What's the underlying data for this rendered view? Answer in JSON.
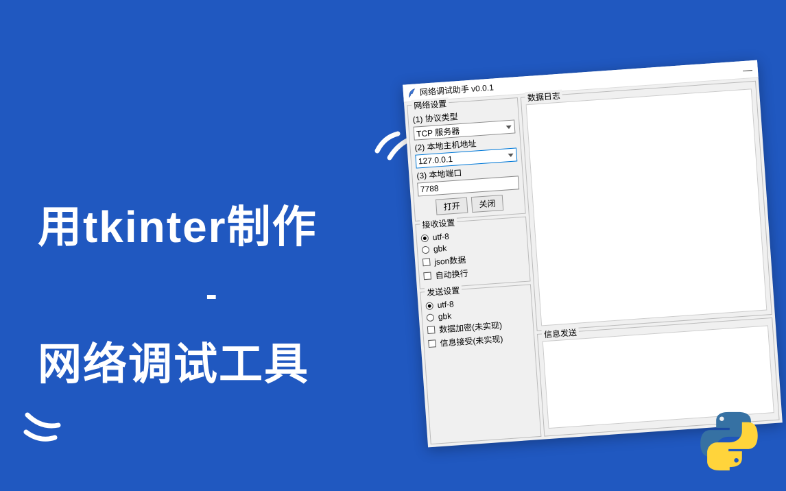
{
  "headline": {
    "line1": "用tkinter制作",
    "dash": "-",
    "line2": "网络调试工具"
  },
  "window": {
    "title": "网络调试助手 v0.0.1"
  },
  "network_settings": {
    "group_title": "网络设置",
    "protocol_label": "(1) 协议类型",
    "protocol_value": "TCP 服务器",
    "host_label": "(2) 本地主机地址",
    "host_value": "127.0.0.1",
    "port_label": "(3) 本地端口",
    "port_value": "7788",
    "open_btn": "打开",
    "close_btn": "关闭"
  },
  "recv_settings": {
    "group_title": "接收设置",
    "radio_utf8": "utf-8",
    "radio_gbk": "gbk",
    "check_json": "json数据",
    "check_wrap": "自动换行"
  },
  "send_settings": {
    "group_title": "发送设置",
    "radio_utf8": "utf-8",
    "radio_gbk": "gbk",
    "check_encrypt": "数据加密(未实现)",
    "check_ack": "信息接受(未实现)"
  },
  "right_panel": {
    "log_title": "数据日志",
    "send_title": "信息发送"
  }
}
